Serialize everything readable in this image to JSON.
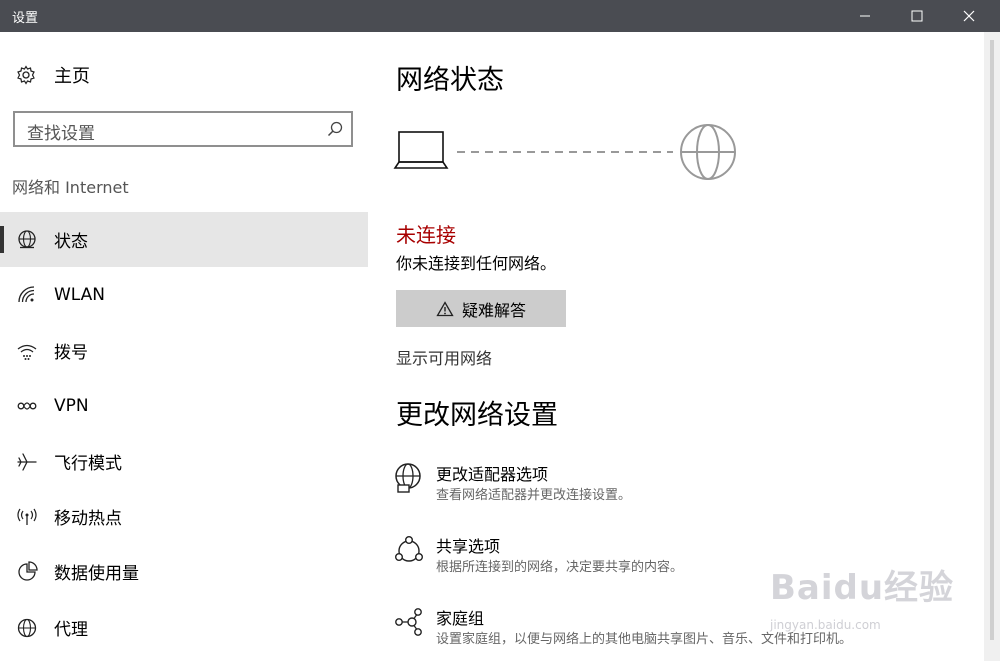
{
  "window": {
    "title": "设置"
  },
  "sidebar": {
    "home_label": "主页",
    "search_placeholder": "查找设置",
    "section_label": "网络和 Internet",
    "items": [
      {
        "label": "状态",
        "icon": "status-globe-icon",
        "active": true
      },
      {
        "label": "WLAN",
        "icon": "wifi-icon"
      },
      {
        "label": "拨号",
        "icon": "dialup-icon"
      },
      {
        "label": "VPN",
        "icon": "vpn-icon"
      },
      {
        "label": "飞行模式",
        "icon": "airplane-icon"
      },
      {
        "label": "移动热点",
        "icon": "hotspot-icon"
      },
      {
        "label": "数据使用量",
        "icon": "data-usage-icon"
      },
      {
        "label": "代理",
        "icon": "proxy-globe-icon"
      }
    ]
  },
  "main": {
    "title": "网络状态",
    "status_title": "未连接",
    "status_desc": "你未连接到任何网络。",
    "troubleshoot_label": "疑难解答",
    "show_networks_link": "显示可用网络",
    "change_title": "更改网络设置",
    "options": [
      {
        "title": "更改适配器选项",
        "desc": "查看网络适配器并更改连接设置。",
        "icon": "adapter-icon"
      },
      {
        "title": "共享选项",
        "desc": "根据所连接到的网络，决定要共享的内容。",
        "icon": "sharing-icon"
      },
      {
        "title": "家庭组",
        "desc": "设置家庭组，以便与网络上的其他电脑共享图片、音乐、文件和打印机。",
        "icon": "homegroup-icon"
      }
    ]
  },
  "colors": {
    "titlebar": "#4a4c52",
    "error": "#a80000",
    "active_bg": "#e6e6e6",
    "button_bg": "#cccccc"
  },
  "watermark": {
    "logo": "Baidu经验",
    "url": "jingyan.baidu.com"
  }
}
